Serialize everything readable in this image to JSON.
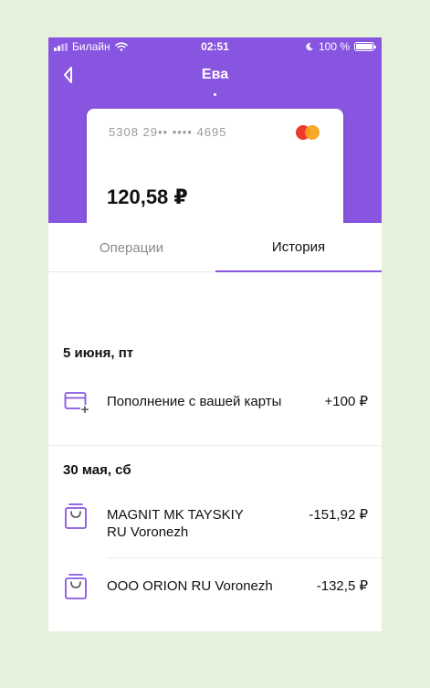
{
  "status_bar": {
    "carrier": "Билайн",
    "time": "02:51",
    "battery": "100 %",
    "battery_level_percent": 100
  },
  "header": {
    "title": "Ева",
    "back_icon": "chevron-left-icon"
  },
  "card": {
    "number": "5308 29•• •••• 4695",
    "balance": "120,58 ₽",
    "logo": "mastercard-icon"
  },
  "tabs": [
    {
      "label": "Операции",
      "active": false
    },
    {
      "label": "История",
      "active": true
    }
  ],
  "history": [
    {
      "date": "5 июня, пт",
      "items": [
        {
          "icon": "card-add-icon",
          "title": "Пополнение с вашей карты",
          "amount": "+100 ₽"
        }
      ]
    },
    {
      "date": "30 мая, сб",
      "items": [
        {
          "icon": "shopping-bag-icon",
          "title": "MAGNIT MK TAYSKIY RU Voronezh",
          "amount": "-151,92 ₽"
        },
        {
          "icon": "shopping-bag-icon",
          "title": "OOO ORION RU Voronezh",
          "amount": "-132,5 ₽"
        }
      ]
    }
  ],
  "colors": {
    "accent": "#8855e0",
    "background": "#e5f1da",
    "text": "#111111",
    "muted": "#8a8a8a"
  }
}
